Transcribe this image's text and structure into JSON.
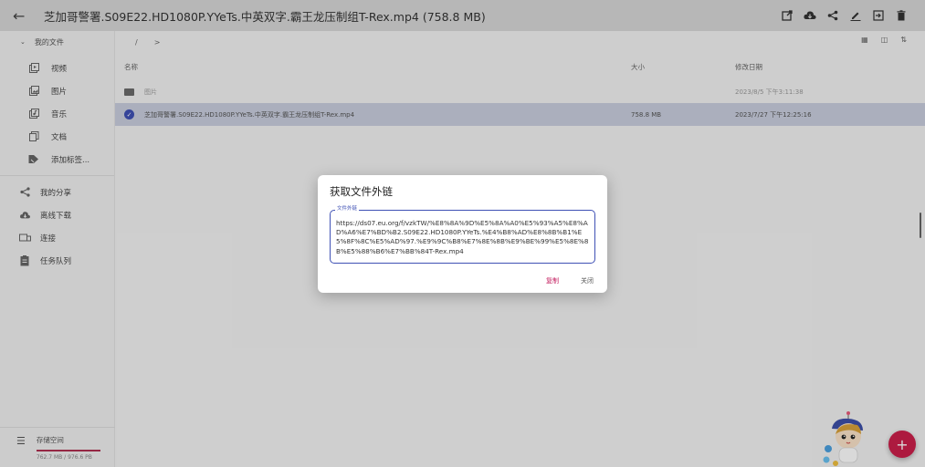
{
  "appbar": {
    "title": "芝加哥警署.S09E22.HD1080P.YYeTs.中英双字.霸王龙压制组T-Rex.mp4 (758.8 MB)",
    "actions": [
      "open-external-icon",
      "cloud-download-icon",
      "share-icon",
      "edit-icon",
      "move-icon",
      "delete-icon"
    ]
  },
  "sidebar": {
    "root_label": "我的文件",
    "sub_items": [
      {
        "label": "视频",
        "icon": "video-icon"
      },
      {
        "label": "图片",
        "icon": "image-icon"
      },
      {
        "label": "音乐",
        "icon": "music-icon"
      },
      {
        "label": "文档",
        "icon": "document-icon"
      },
      {
        "label": "添加标签...",
        "icon": "tag-icon"
      }
    ],
    "main_items": [
      {
        "label": "我的分享",
        "icon": "share-icon"
      },
      {
        "label": "离线下载",
        "icon": "cloud-download-icon"
      },
      {
        "label": "连接",
        "icon": "connect-icon"
      },
      {
        "label": "任务队列",
        "icon": "task-queue-icon"
      }
    ],
    "storage": {
      "title": "存储空间",
      "usage": "762.7 MB / 976.6 PB",
      "used_fraction": 1.0
    }
  },
  "main": {
    "breadcrumb": [
      "/",
      ">"
    ],
    "columns": {
      "name": "名称",
      "size": "大小",
      "date": "修改日期"
    },
    "rows": [
      {
        "name": "图片",
        "size": "",
        "date": "2023/8/5 下午3:11:38",
        "type": "folder"
      },
      {
        "name": "芝加哥警署.S09E22.HD1080P.YYeTs.中英双字.霸王龙压制组T-Rex.mp4",
        "size": "758.8 MB",
        "date": "2023/7/27 下午12:25:16",
        "type": "file"
      }
    ]
  },
  "dialog": {
    "title": "获取文件外链",
    "field_label": "文件外链",
    "link": "https://ds07.eu.org/f/vzkTW/%E8%8A%9D%E5%8A%A0%E5%93%A5%E8%AD%A6%E7%BD%B2.S09E22.HD1080P.YYeTs.%E4%B8%AD%E8%8B%B1%E5%8F%8C%E5%AD%97.%E9%9C%B8%E7%8E%8B%E9%BE%99%E5%8E%8B%E5%88%B6%E7%BB%84T-Rex.mp4",
    "copy_label": "复制",
    "close_label": "关闭"
  },
  "colors": {
    "accent": "#3f51b5",
    "fab": "#cc1f4a",
    "copy_button": "#c2185b"
  }
}
